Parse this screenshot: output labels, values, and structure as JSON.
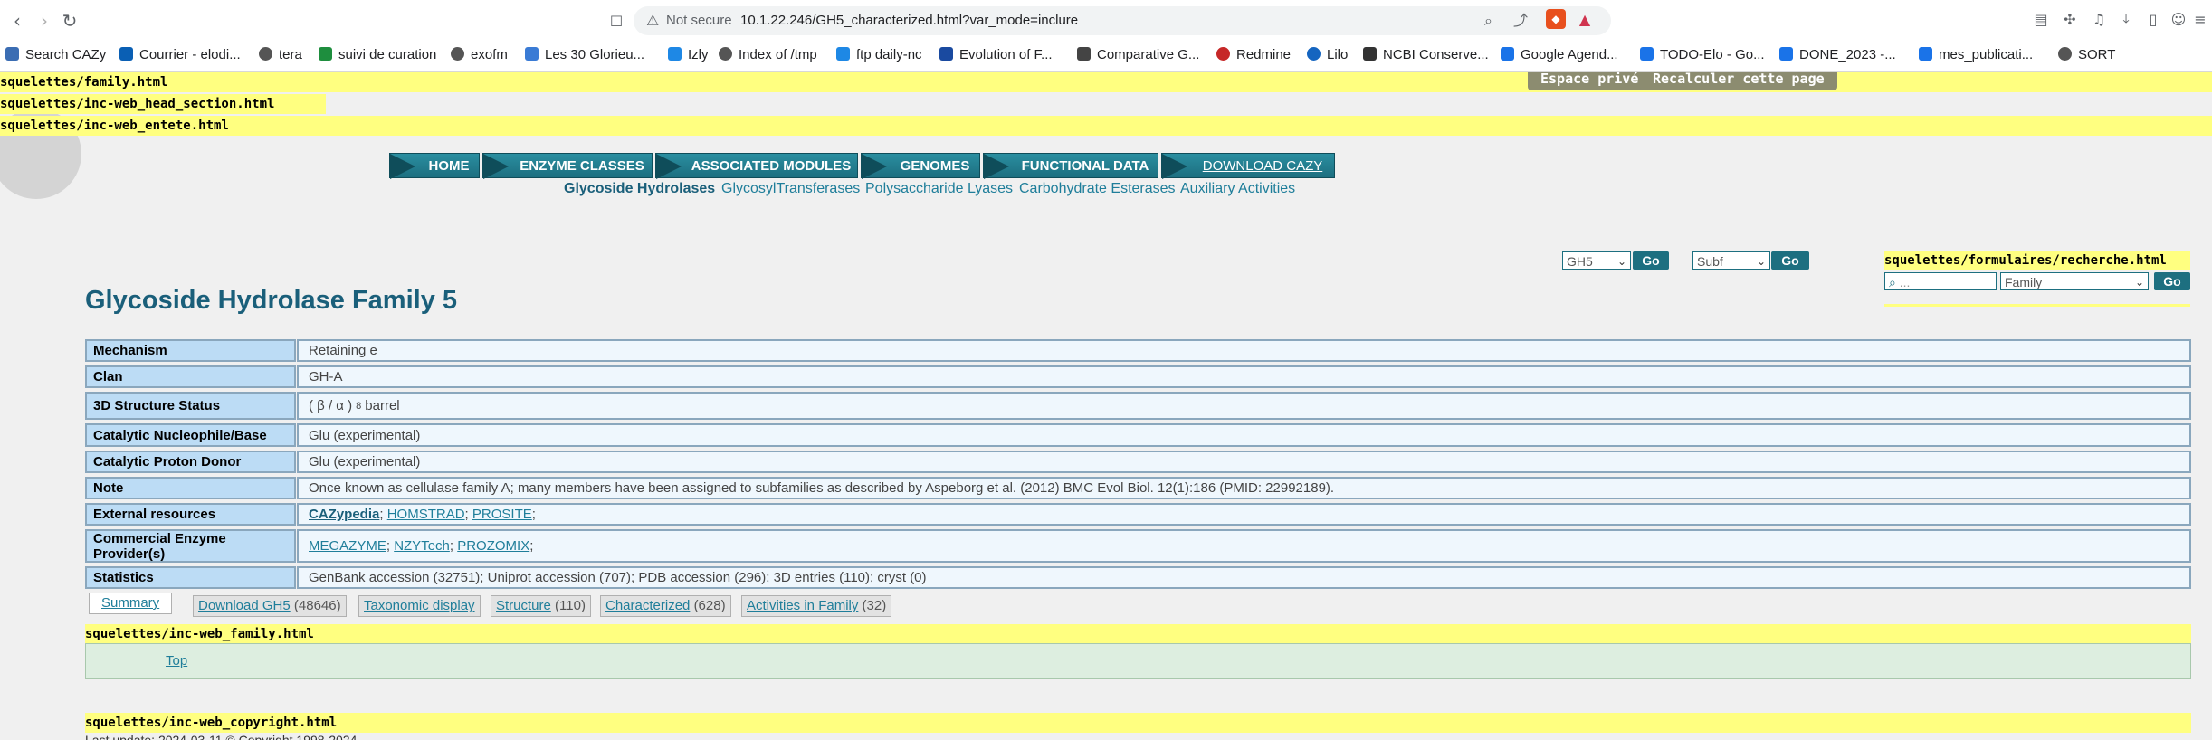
{
  "browser": {
    "security_label": "Not secure",
    "url": "10.1.22.246/GH5_characterized.html?var_mode=inclure",
    "bookmarks": [
      {
        "label": "Search CAZy",
        "color": "#3b6db3"
      },
      {
        "label": "Courrier - elodi...",
        "color": "#0a5fb4"
      },
      {
        "label": "tera",
        "color": "#555555"
      },
      {
        "label": "suivi de curation",
        "color": "#1e8e3e"
      },
      {
        "label": "exofm",
        "color": "#555555"
      },
      {
        "label": "Les 30 Glorieu...",
        "color": "#3a7bd5"
      },
      {
        "label": "Izly",
        "color": "#1e88e5"
      },
      {
        "label": "Index of /tmp",
        "color": "#555555"
      },
      {
        "label": "ftp daily-nc",
        "color": "#1e88e5"
      },
      {
        "label": "Evolution of F...",
        "color": "#1a4aa0"
      },
      {
        "label": "Comparative G...",
        "color": "#444444"
      },
      {
        "label": "Redmine",
        "color": "#c62828"
      },
      {
        "label": "Lilo",
        "color": "#1565c0"
      },
      {
        "label": "NCBI Conserve...",
        "color": "#333333"
      },
      {
        "label": "Google Agend...",
        "color": "#1a73e8"
      },
      {
        "label": "TODO-Elo - Go...",
        "color": "#1a73e8"
      },
      {
        "label": "DONE_2023 -...",
        "color": "#1a73e8"
      },
      {
        "label": "mes_publicati...",
        "color": "#1a73e8"
      },
      {
        "label": "SORT",
        "color": "#555555"
      }
    ]
  },
  "spip": {
    "family": "squelettes/family.html",
    "head": "squelettes/inc-web_head_section.html",
    "entete": "squelettes/inc-web_entete.html",
    "espace_prive": "Espace privé",
    "recalculer": "Recalculer cette page",
    "recherche": "squelettes/formulaires/recherche.html",
    "inc_family": "squelettes/inc-web_family.html",
    "copyright": "squelettes/inc-web_copyright.html"
  },
  "menu": {
    "tabs": [
      "HOME",
      "ENZYME CLASSES",
      "ASSOCIATED MODULES",
      "GENOMES",
      "FUNCTIONAL DATA",
      "DOWNLOAD CAZY"
    ],
    "submenu": [
      "Glycoside Hydrolases",
      "GlycosylTransferases",
      "Polysaccharide Lyases",
      "Carbohydrate Esterases",
      "Auxiliary Activities"
    ]
  },
  "nav_forms": {
    "family_select": "GH5",
    "subf_select": "Subf",
    "go": "Go",
    "search_placeholder": "...",
    "search_type": "Family"
  },
  "page_title": "Glycoside Hydrolase Family 5",
  "info": {
    "mechanism_label": "Mechanism",
    "mechanism": "Retaining e",
    "clan_label": "Clan",
    "clan": "GH-A",
    "structure_label": "3D Structure Status",
    "structure_prefix": "( β / α )",
    "structure_sub": "8",
    "structure_suffix": "barrel",
    "nucleophile_label": "Catalytic Nucleophile/Base",
    "nucleophile": "Glu (experimental)",
    "proton_label": "Catalytic Proton Donor",
    "proton": "Glu (experimental)",
    "note_label": "Note",
    "note": "Once known as cellulase family A; many members have been assigned to subfamilies as described by Aspeborg et al. (2012) BMC Evol Biol. 12(1):186 (PMID: 22992189).",
    "external_label": "External resources",
    "external_links": [
      "CAZypedia",
      "HOMSTRAD",
      "PROSITE"
    ],
    "commercial_label": "Commercial Enzyme Provider(s)",
    "commercial_links": [
      "MEGAZYME",
      "NZYTech",
      "PROZOMIX"
    ],
    "statistics_label": "Statistics",
    "statistics": "GenBank accession (32751); Uniprot accession (707); PDB accession (296); 3D entries (110); cryst (0)"
  },
  "subtabs": {
    "summary": "Summary",
    "download": "Download GH5",
    "download_count": "(48646)",
    "taxonomic": "Taxonomic display",
    "structure": "Structure",
    "structure_count": "(110)",
    "characterized": "Characterized",
    "characterized_count": "(628)",
    "activities": "Activities in Family",
    "activities_count": "(32)"
  },
  "top_link": "Top",
  "bottom_text": "Last update: 2024-03-11 © Copyright 1998-2024"
}
